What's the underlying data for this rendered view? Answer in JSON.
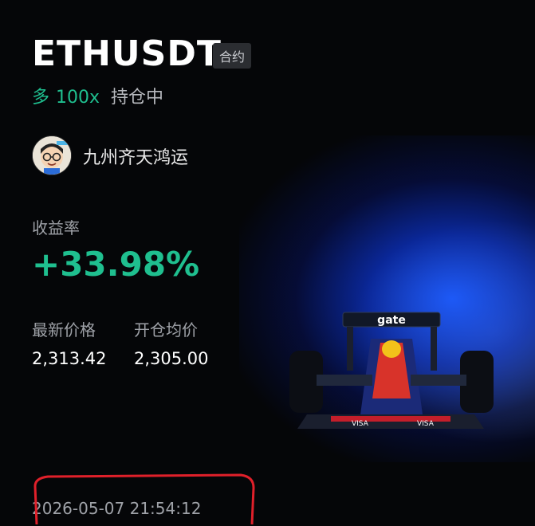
{
  "symbol": "ETHUSDT",
  "contract_tag": "合约",
  "position": {
    "side": "多",
    "leverage": "100x",
    "status": "持仓中"
  },
  "user": {
    "name": "九州齐天鸿运",
    "avatar_icon": "cartoon-avatar-icon"
  },
  "yield": {
    "label": "收益率",
    "value": "+33.98%"
  },
  "stats": {
    "latest_price_label": "最新价格",
    "latest_price": "2,313.42",
    "entry_price_label": "开仓均价",
    "entry_price": "2,305.00"
  },
  "timestamp": "2026-05-07 21:54:12",
  "colors": {
    "accent_green": "#1fbf8f",
    "background": "#050608",
    "annotation_red": "#e0202a"
  }
}
